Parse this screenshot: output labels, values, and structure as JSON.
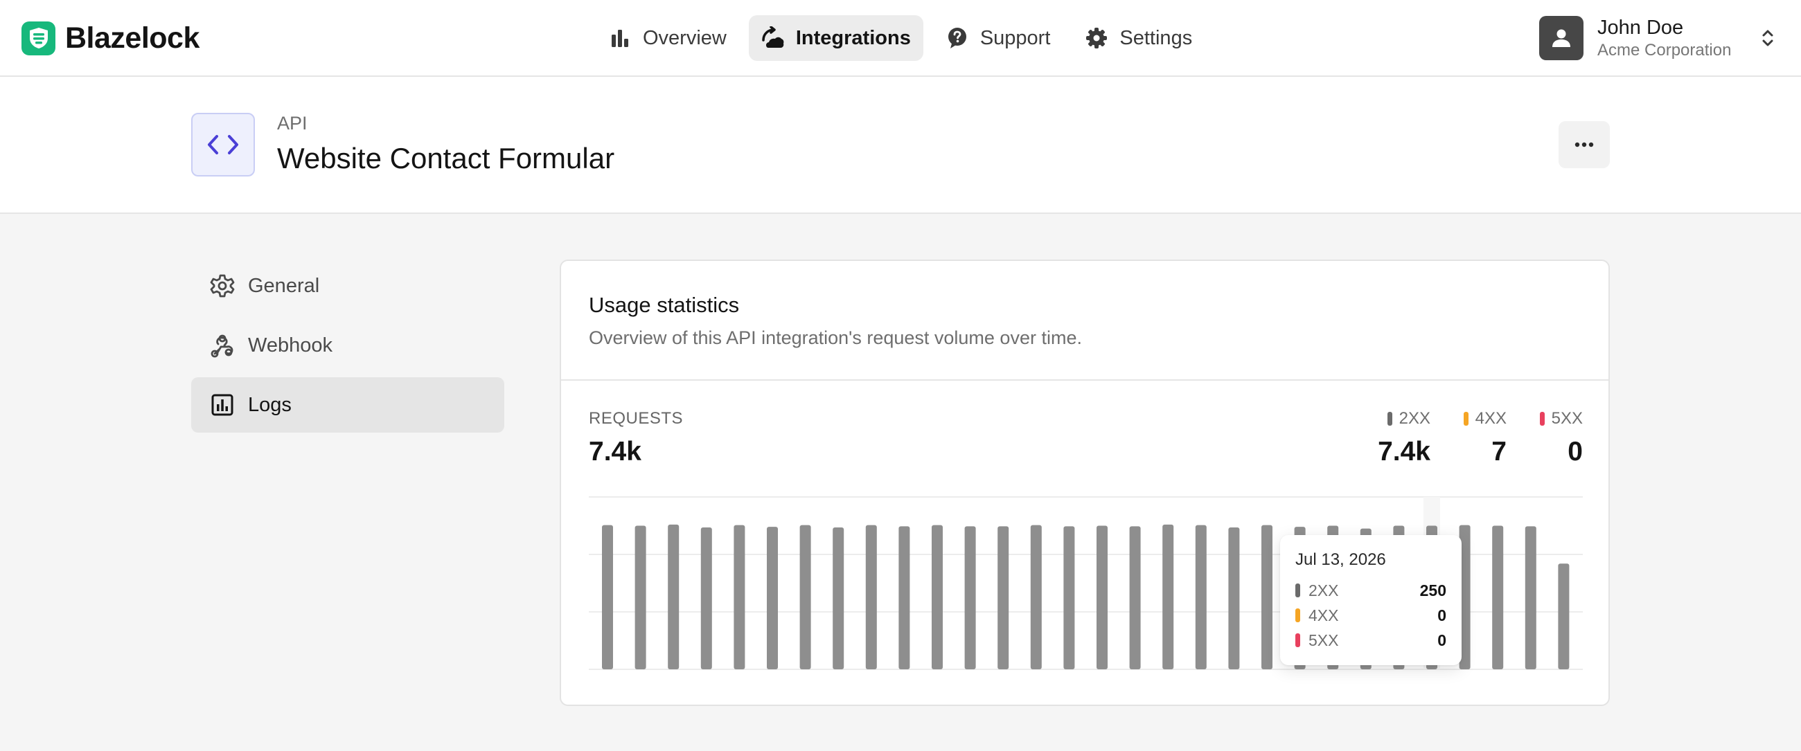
{
  "app": {
    "name": "Blazelock",
    "brand_color": "#17b87c"
  },
  "nav": [
    {
      "label": "Overview",
      "icon": "bar-chart-icon",
      "active": false
    },
    {
      "label": "Integrations",
      "icon": "integrations-icon",
      "active": true
    },
    {
      "label": "Support",
      "icon": "help-circle-icon",
      "active": false
    },
    {
      "label": "Settings",
      "icon": "gear-icon",
      "active": false
    }
  ],
  "account": {
    "name": "John Doe",
    "org": "Acme Corporation"
  },
  "integration": {
    "kicker": "API",
    "title": "Website Contact Formular"
  },
  "side_menu": [
    {
      "label": "General",
      "icon": "gear-icon",
      "active": false
    },
    {
      "label": "Webhook",
      "icon": "webhook-icon",
      "active": false
    },
    {
      "label": "Logs",
      "icon": "chart-box-icon",
      "active": true
    }
  ],
  "card": {
    "title": "Usage statistics",
    "subtitle": "Overview of this API integration's request volume over time."
  },
  "stats": {
    "requests_label": "REQUESTS",
    "requests_value": "7.4k",
    "legend": [
      {
        "label": "2XX",
        "value": "7.4k",
        "color": "#6b6b6b"
      },
      {
        "label": "4XX",
        "value": "7",
        "color": "#f5a524"
      },
      {
        "label": "5XX",
        "value": "0",
        "color": "#e8405e"
      }
    ]
  },
  "tooltip": {
    "date": "Jul 13, 2026",
    "rows": [
      {
        "label": "2XX",
        "value": "250",
        "color": "#6b6b6b"
      },
      {
        "label": "4XX",
        "value": "0",
        "color": "#f5a524"
      },
      {
        "label": "5XX",
        "value": "0",
        "color": "#e8405e"
      }
    ]
  },
  "chart_data": {
    "type": "bar",
    "title": "",
    "xlabel": "",
    "ylabel": "",
    "bar_color": "#8e8e8e",
    "grid": true,
    "ylim": [
      0,
      300
    ],
    "series": [
      {
        "name": "2XX",
        "values": [
          251,
          250,
          252,
          247,
          251,
          248,
          251,
          247,
          251,
          249,
          251,
          249,
          249,
          251,
          249,
          250,
          249,
          252,
          251,
          247,
          251,
          248,
          250,
          245,
          250,
          250,
          251,
          250,
          249,
          184
        ]
      }
    ],
    "highlight_index": 25
  }
}
